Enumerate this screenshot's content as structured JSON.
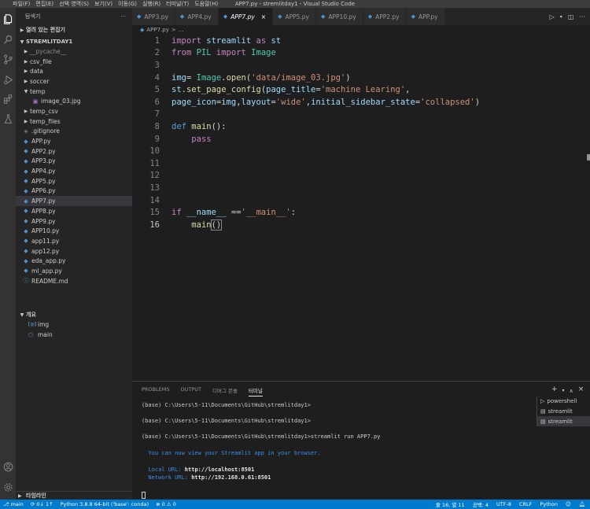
{
  "window": {
    "title": "APP7.py - stremlitday1 - Visual Studio Code",
    "menu": [
      "파일(F)",
      "편집(E)",
      "선택 영역(S)",
      "보기(V)",
      "이동(G)",
      "실행(R)",
      "터미널(T)",
      "도움말(H)"
    ]
  },
  "sidebar": {
    "title": "탐색기",
    "more": "···",
    "open_editors": "열려 있는 편집기",
    "project": "STREMLITDAY1",
    "tree": [
      {
        "label": "__pycache__",
        "kind": "folder",
        "indent": 1,
        "open": false,
        "muted": true
      },
      {
        "label": "csv_file",
        "kind": "folder",
        "indent": 1,
        "open": false
      },
      {
        "label": "data",
        "kind": "folder",
        "indent": 1,
        "open": false
      },
      {
        "label": "soccer",
        "kind": "folder",
        "indent": 1,
        "open": false
      },
      {
        "label": "temp",
        "kind": "folder",
        "indent": 1,
        "open": true
      },
      {
        "label": "image_03.jpg",
        "kind": "image",
        "indent": 2
      },
      {
        "label": "temp_csv",
        "kind": "folder",
        "indent": 1,
        "open": false
      },
      {
        "label": "temp_files",
        "kind": "folder",
        "indent": 1,
        "open": false
      },
      {
        "label": ".gitignore",
        "kind": "git",
        "indent": 1
      },
      {
        "label": "APP.py",
        "kind": "py",
        "indent": 1
      },
      {
        "label": "APP2.py",
        "kind": "py",
        "indent": 1
      },
      {
        "label": "APP3.py",
        "kind": "py",
        "indent": 1
      },
      {
        "label": "APP4.py",
        "kind": "py",
        "indent": 1
      },
      {
        "label": "APP5.py",
        "kind": "py",
        "indent": 1
      },
      {
        "label": "APP6.py",
        "kind": "py",
        "indent": 1
      },
      {
        "label": "APP7.py",
        "kind": "py",
        "indent": 1,
        "active": true
      },
      {
        "label": "APP8.py",
        "kind": "py",
        "indent": 1
      },
      {
        "label": "APP9.py",
        "kind": "py",
        "indent": 1
      },
      {
        "label": "APP10.py",
        "kind": "py",
        "indent": 1
      },
      {
        "label": "app11.py",
        "kind": "py",
        "indent": 1
      },
      {
        "label": "app12.py",
        "kind": "py",
        "indent": 1
      },
      {
        "label": "eda_app.py",
        "kind": "py",
        "indent": 1
      },
      {
        "label": "ml_app.py",
        "kind": "py",
        "indent": 1
      },
      {
        "label": "README.md",
        "kind": "info",
        "indent": 1
      }
    ],
    "outline_title": "개요",
    "outline": [
      {
        "label": "img",
        "icon": "variable"
      },
      {
        "label": "main",
        "icon": "function"
      }
    ],
    "timeline": "타임라인"
  },
  "tabs": [
    {
      "label": "APP3.py",
      "active": false
    },
    {
      "label": "APP4.py",
      "active": false
    },
    {
      "label": "APP7.py",
      "active": true
    },
    {
      "label": "APP5.py",
      "active": false
    },
    {
      "label": "APP10.py",
      "active": false
    },
    {
      "label": "APP2.py",
      "active": false
    },
    {
      "label": "APP.py",
      "active": false
    }
  ],
  "breadcrumb": {
    "file": "APP7.py",
    "sep": ">",
    "symbol": "..."
  },
  "editor": {
    "current_line": 16,
    "lines": [
      {
        "n": "1",
        "tokens": [
          [
            "kw",
            "import "
          ],
          [
            "vr",
            "streamlit"
          ],
          [
            "pl",
            " "
          ],
          [
            "kw",
            "as "
          ],
          [
            "vr",
            "st"
          ]
        ]
      },
      {
        "n": "2",
        "tokens": [
          [
            "kw",
            "from "
          ],
          [
            "cl",
            "PIL"
          ],
          [
            "pl",
            " "
          ],
          [
            "kw",
            "import "
          ],
          [
            "cl",
            "Image"
          ]
        ]
      },
      {
        "n": "3",
        "tokens": []
      },
      {
        "n": "4",
        "tokens": [
          [
            "vr",
            "img"
          ],
          [
            "pl",
            "= "
          ],
          [
            "cl",
            "Image"
          ],
          [
            "pl",
            "."
          ],
          [
            "fn",
            "open"
          ],
          [
            "pl",
            "("
          ],
          [
            "st",
            "'data/image_03.jpg'"
          ],
          [
            "pl",
            ")"
          ]
        ]
      },
      {
        "n": "5",
        "tokens": [
          [
            "vr",
            "st"
          ],
          [
            "pl",
            "."
          ],
          [
            "fn",
            "set_page_config"
          ],
          [
            "pl",
            "("
          ],
          [
            "vr",
            "page_title"
          ],
          [
            "pl",
            "="
          ],
          [
            "st",
            "'machine Learing'"
          ],
          [
            "pl",
            ","
          ]
        ]
      },
      {
        "n": "6",
        "tokens": [
          [
            "vr",
            "page_icon"
          ],
          [
            "pl",
            "="
          ],
          [
            "vr",
            "img"
          ],
          [
            "pl",
            ","
          ],
          [
            "vr",
            "layout"
          ],
          [
            "pl",
            "="
          ],
          [
            "st",
            "'wide'"
          ],
          [
            "pl",
            ","
          ],
          [
            "vr",
            "initial_sidebar_state"
          ],
          [
            "pl",
            "="
          ],
          [
            "st",
            "'collapsed'"
          ],
          [
            "pl",
            ")"
          ]
        ]
      },
      {
        "n": "7",
        "tokens": []
      },
      {
        "n": "8",
        "tokens": [
          [
            "df",
            "def "
          ],
          [
            "fn",
            "main"
          ],
          [
            "pl",
            "():"
          ]
        ]
      },
      {
        "n": "9",
        "tokens": [
          [
            "pl",
            "    "
          ],
          [
            "kw",
            "pass"
          ]
        ]
      },
      {
        "n": "10",
        "tokens": []
      },
      {
        "n": "11",
        "tokens": []
      },
      {
        "n": "12",
        "tokens": []
      },
      {
        "n": "13",
        "tokens": []
      },
      {
        "n": "14",
        "tokens": []
      },
      {
        "n": "15",
        "tokens": [
          [
            "kw",
            "if "
          ],
          [
            "vr",
            "__name__"
          ],
          [
            "pl",
            " =="
          ],
          [
            "st",
            "'__main__'"
          ],
          [
            "pl",
            ":"
          ]
        ]
      },
      {
        "n": "16",
        "tokens": [
          [
            "pl",
            "    "
          ],
          [
            "fn",
            "main"
          ],
          [
            "bm",
            "()"
          ]
        ]
      }
    ]
  },
  "panel": {
    "tabs": [
      "PROBLEMS",
      "OUTPUT",
      "디버그 콘솔",
      "터미널"
    ],
    "active_tab": "터미널",
    "terminal_lines": [
      {
        "text": "(base) C:\\Users\\5-11\\Documents\\GitHub\\stremlitday1>",
        "style": "plain"
      },
      {
        "text": "(base) C:\\Users\\5-11\\Documents\\GitHub\\stremlitday1>",
        "style": "plain"
      },
      {
        "text": "(base) C:\\Users\\5-11\\Documents\\GitHub\\stremlitday1>streamlit run APP7.py",
        "style": "plain"
      },
      {
        "text": "  You can now view your Streamlit app in your browser.",
        "style": "blue"
      },
      {
        "label": "  Local URL: ",
        "value": "http://localhost:8501",
        "style": "url"
      },
      {
        "label": "  Network URL: ",
        "value": "http://192.168.0.61:8501",
        "style": "url"
      }
    ],
    "terminals": [
      {
        "label": "powershell",
        "active": false
      },
      {
        "label": "streamlit",
        "active": false
      },
      {
        "label": "streamlit",
        "active": true
      }
    ]
  },
  "status": {
    "branch": "main",
    "sync": "0↓ 1↑",
    "interpreter": "Python 3.8.8 64-bit ('base': conda)",
    "problems": "⊗ 0 ⚠ 0",
    "position": "줄 16, 열 11",
    "indent": "공백: 4",
    "encoding": "UTF-8",
    "eol": "CRLF",
    "language": "Python"
  },
  "colors": {
    "statusbar": "#007acc",
    "activity_bar": "#333333",
    "sidebar": "#252526",
    "editor": "#1e1e1e"
  }
}
